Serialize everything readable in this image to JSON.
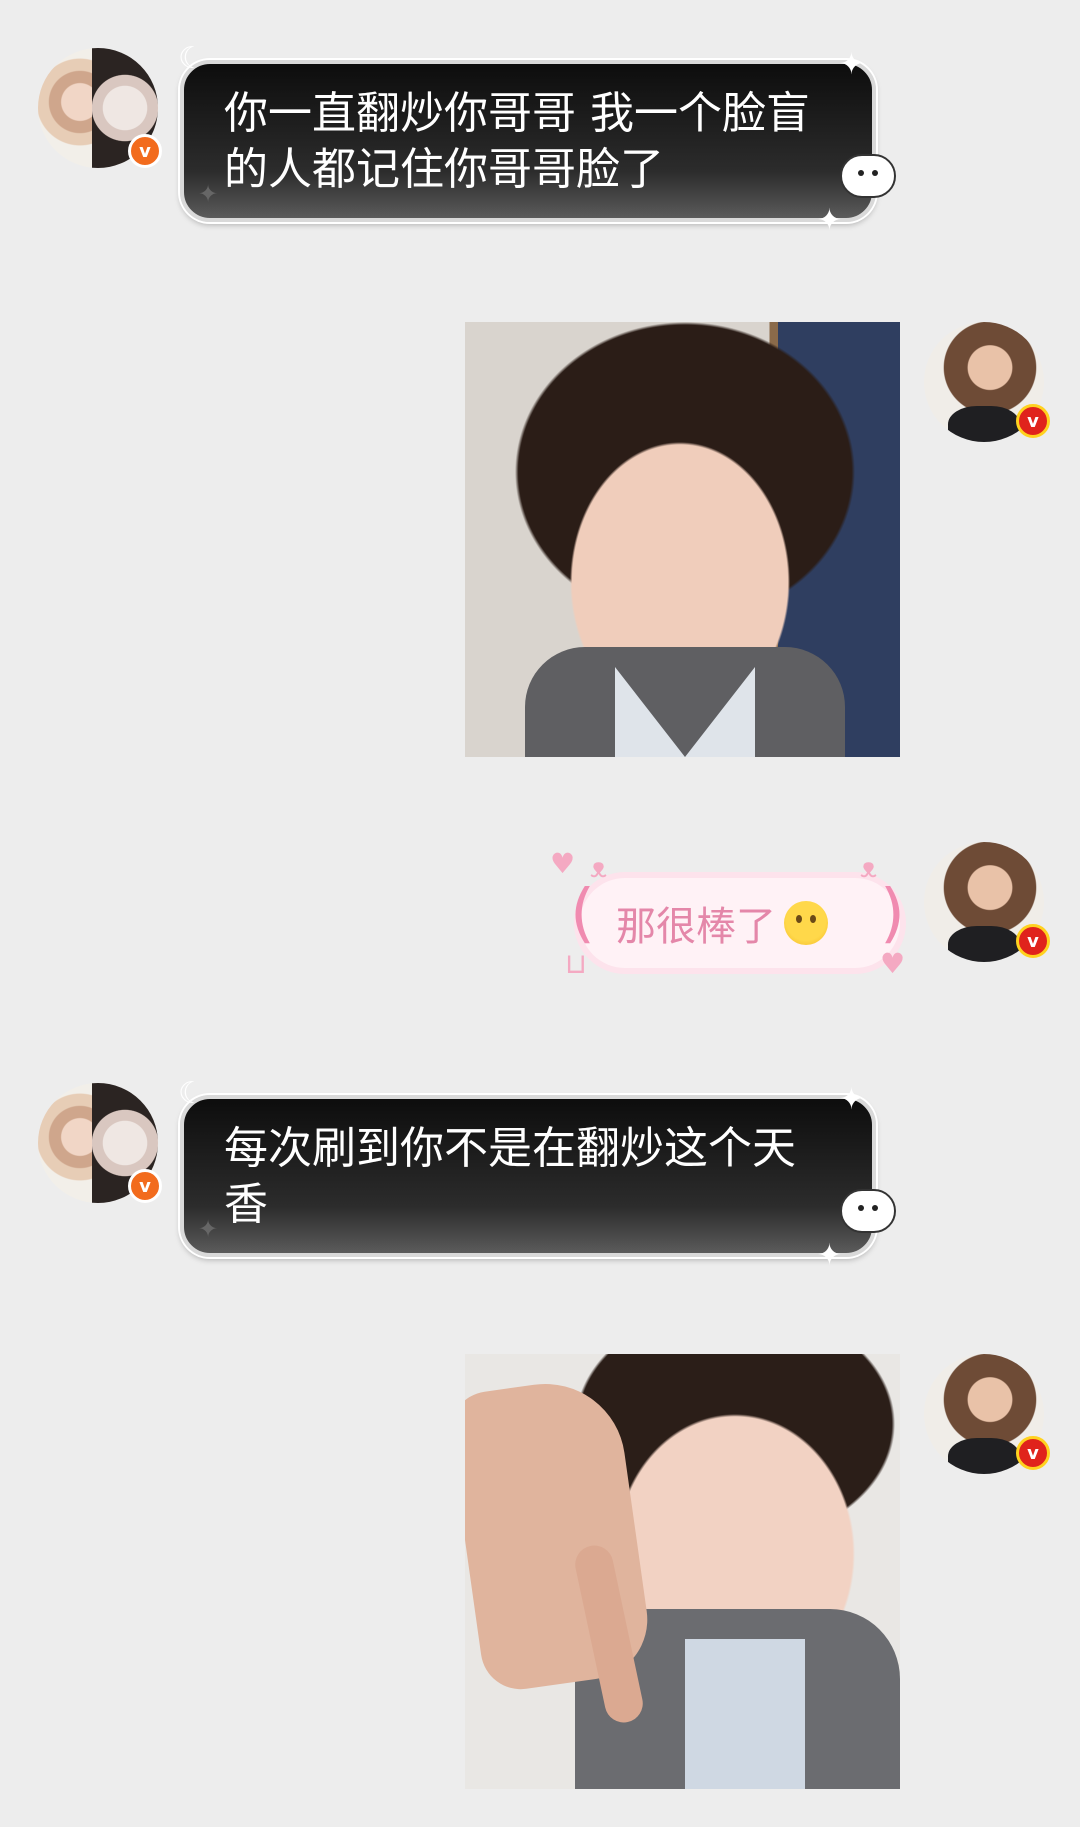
{
  "messages": [
    {
      "side": "left",
      "type": "text",
      "text": "你一直翻炒你哥哥 我一个脸盲的人都记住你哥哥脸了",
      "verified_badge": "v"
    },
    {
      "side": "right",
      "type": "image",
      "image_desc": "selfie-photo",
      "verified_badge": "v"
    },
    {
      "side": "right",
      "type": "sticker-text",
      "text": "那很棒了",
      "emoji": "pleading-face",
      "verified_badge": "v"
    },
    {
      "side": "left",
      "type": "text",
      "text": "每次刷到你不是在翻炒这个天香",
      "verified_badge": "v"
    },
    {
      "side": "right",
      "type": "image",
      "image_desc": "pointing-photo",
      "verified_badge": "v"
    }
  ],
  "colors": {
    "background": "#ededed",
    "dark_bubble": "#111111",
    "dark_bubble_text": "#ffffff",
    "pink_bubble": "#fff2f6",
    "pink_text": "#e487a9",
    "badge_orange": "#f26b1d",
    "badge_red": "#e0231c",
    "badge_ring_yellow": "#ffd21f"
  }
}
